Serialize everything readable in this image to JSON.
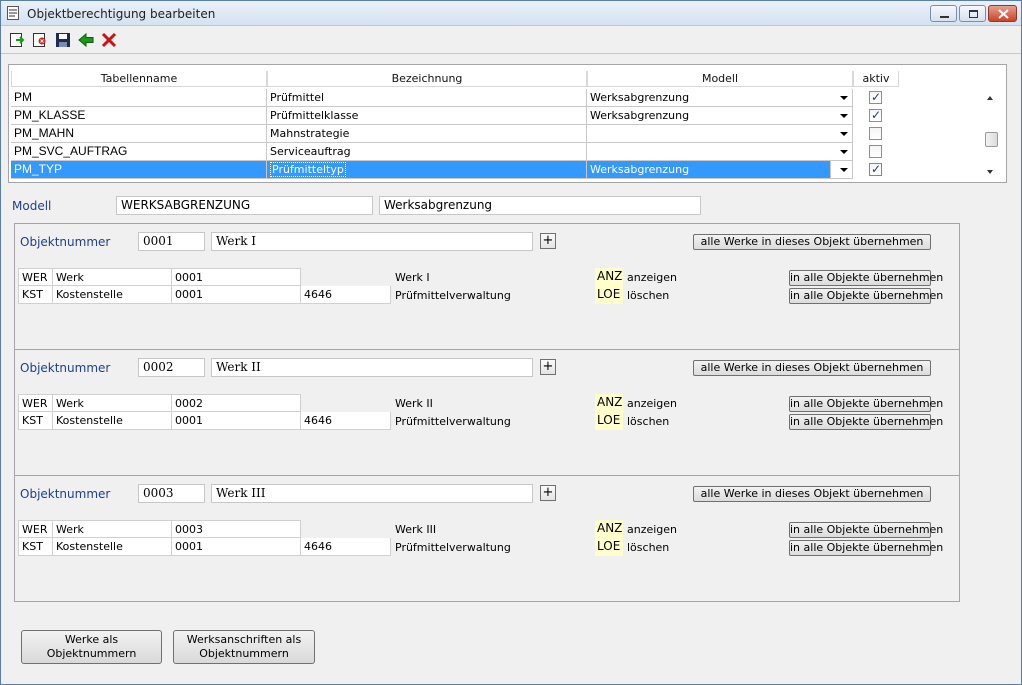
{
  "window": {
    "title": "Objektberechtigung bearbeiten",
    "icons": [
      "document-icon",
      "minimize-icon",
      "maximize-icon",
      "close-icon"
    ]
  },
  "toolbar": {
    "icons": [
      "new-record-icon",
      "delete-record-icon",
      "save-icon",
      "back-arrow-icon",
      "cancel-icon"
    ]
  },
  "grid": {
    "columns": [
      "Tabellenname",
      "Bezeichnung",
      "Modell",
      "aktiv"
    ],
    "rows": [
      {
        "tabellenname": "PM",
        "bezeichnung": "Prüfmittel",
        "modell": "Werksabgrenzung",
        "aktiv": true
      },
      {
        "tabellenname": "PM_KLASSE",
        "bezeichnung": "Prüfmittelklasse",
        "modell": "Werksabgrenzung",
        "aktiv": true
      },
      {
        "tabellenname": "PM_MAHN",
        "bezeichnung": "Mahnstrategie",
        "modell": "",
        "aktiv": false
      },
      {
        "tabellenname": "PM_SVC_AUFTRAG",
        "bezeichnung": "Serviceauftrag",
        "modell": "",
        "aktiv": false
      },
      {
        "tabellenname": "PM_TYP",
        "bezeichnung": "Prüfmitteltyp",
        "modell": "Werksabgrenzung",
        "aktiv": true,
        "selected": true
      }
    ]
  },
  "modell": {
    "label": "Modell",
    "code": "WERKSABGRENZUNG",
    "name": "Werksabgrenzung"
  },
  "objects": [
    {
      "label": "Objektnummer",
      "number": "0001",
      "name": "Werk I",
      "plus": "+",
      "apply_all_button": "alle Werke in dieses Objekt übernehmen",
      "lines": [
        {
          "code": "WER",
          "type": "Werk",
          "value": "0001",
          "extra": "",
          "desc": "Werk I",
          "perm": "ANZ",
          "perm_text": "anzeigen",
          "button": "in alle Objekte übernehmen"
        },
        {
          "code": "KST",
          "type": "Kostenstelle",
          "value": "0001",
          "extra": "4646",
          "desc": "Prüfmittelverwaltung",
          "perm": "LOE",
          "perm_text": "löschen",
          "button": "in alle Objekte übernehmen"
        }
      ]
    },
    {
      "label": "Objektnummer",
      "number": "0002",
      "name": "Werk II",
      "plus": "+",
      "apply_all_button": "alle Werke in dieses Objekt übernehmen",
      "lines": [
        {
          "code": "WER",
          "type": "Werk",
          "value": "0002",
          "extra": "",
          "desc": "Werk II",
          "perm": "ANZ",
          "perm_text": "anzeigen",
          "button": "in alle Objekte übernehmen"
        },
        {
          "code": "KST",
          "type": "Kostenstelle",
          "value": "0001",
          "extra": "4646",
          "desc": "Prüfmittelverwaltung",
          "perm": "LOE",
          "perm_text": "löschen",
          "button": "in alle Objekte übernehmen"
        }
      ]
    },
    {
      "label": "Objektnummer",
      "number": "0003",
      "name": "Werk III",
      "plus": "+",
      "apply_all_button": "alle Werke in dieses Objekt übernehmen",
      "lines": [
        {
          "code": "WER",
          "type": "Werk",
          "value": "0003",
          "extra": "",
          "desc": "Werk III",
          "perm": "ANZ",
          "perm_text": "anzeigen",
          "button": "in alle Objekte übernehmen"
        },
        {
          "code": "KST",
          "type": "Kostenstelle",
          "value": "0001",
          "extra": "4646",
          "desc": "Prüfmittelverwaltung",
          "perm": "LOE",
          "perm_text": "löschen",
          "button": "in alle Objekte übernehmen"
        }
      ]
    }
  ],
  "footer": {
    "btn_werke": "Werke als Objektnummern",
    "btn_anschriften_1": "Werksanschriften als",
    "btn_anschriften_2": "Objektnummern"
  },
  "colors": {
    "selection": "#3399ff",
    "label_blue": "#1f3f8a",
    "permission_bg": "#ffffcc",
    "cancel_red": "#cc1111",
    "back_green": "#1a9a1a"
  }
}
